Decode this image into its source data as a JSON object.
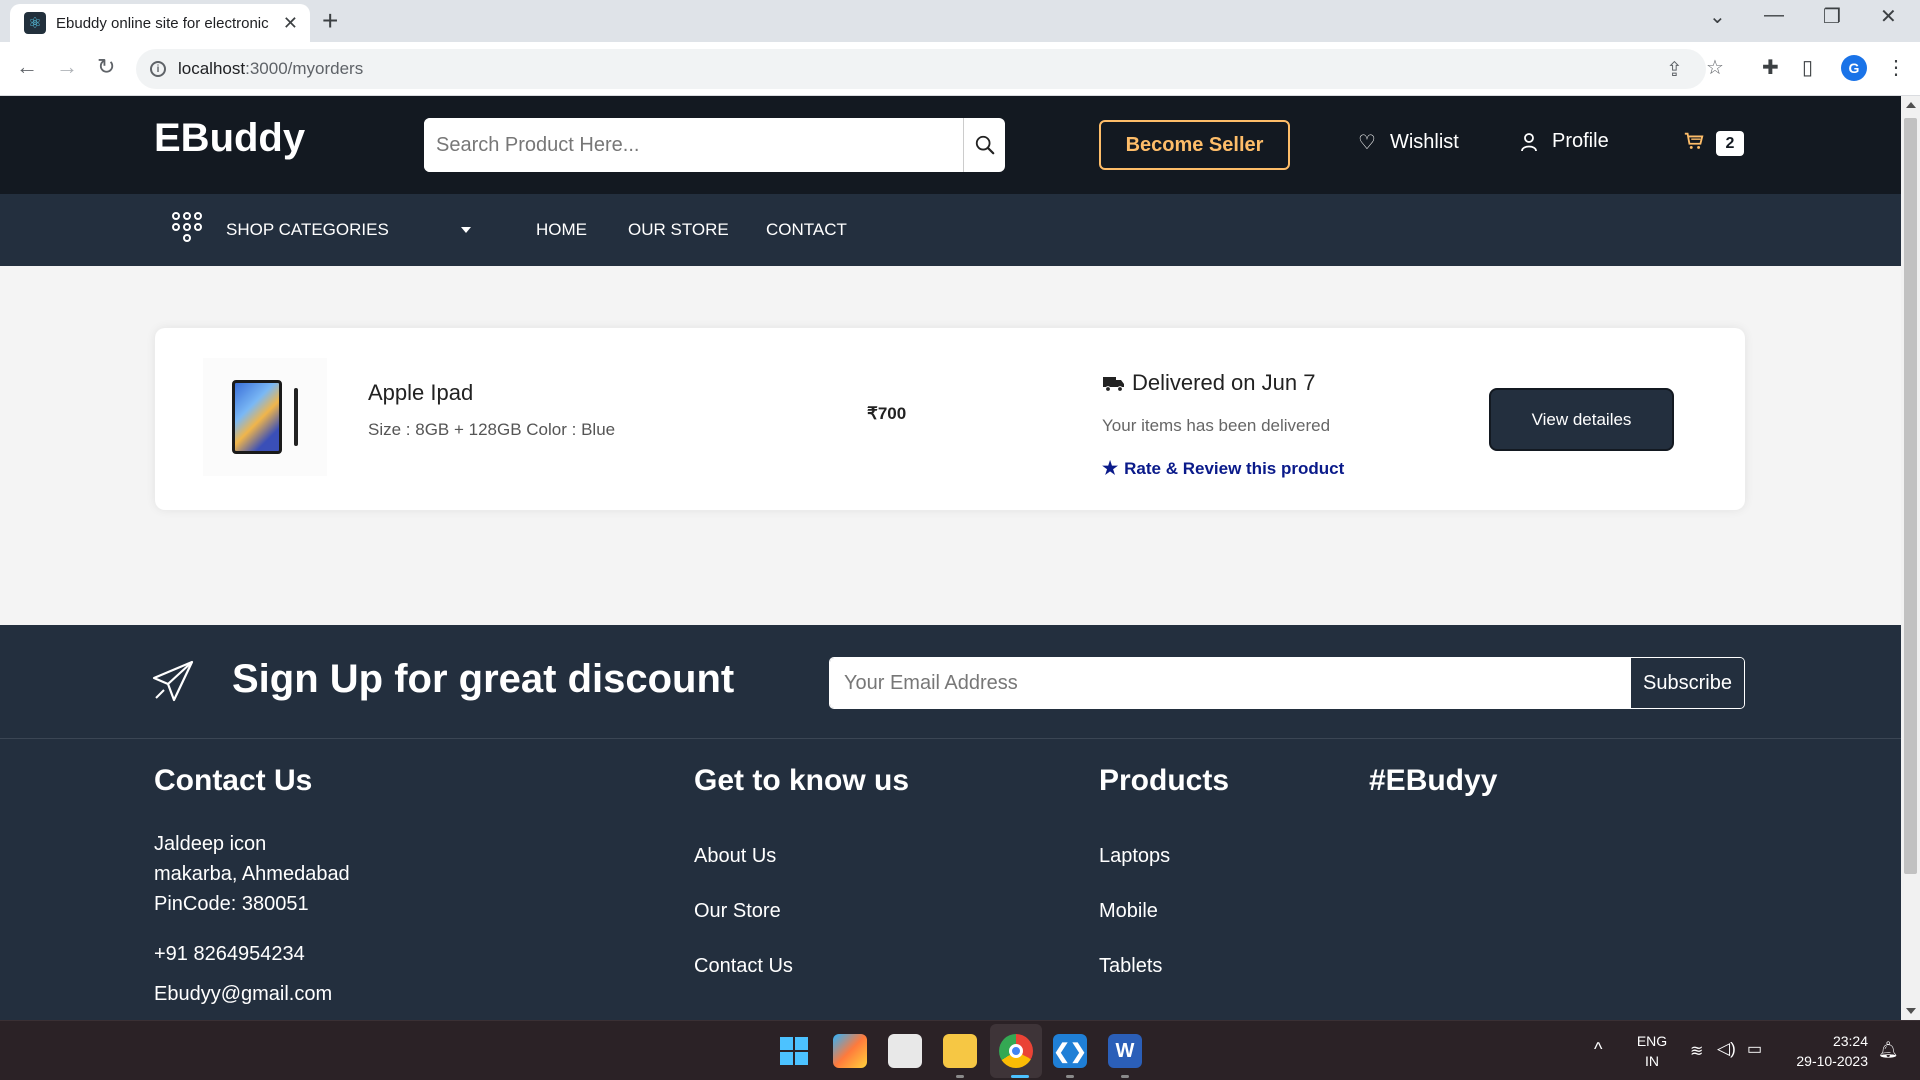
{
  "browser": {
    "tab_title": "Ebuddy online site for electronic",
    "url_host": "localhost",
    "url_path": ":3000/myorders"
  },
  "header": {
    "logo": "EBuddy",
    "search_placeholder": "Search Product Here...",
    "become_seller": "Become Seller",
    "wishlist": "Wishlist",
    "profile": "Profile",
    "cart_count": "2"
  },
  "nav": {
    "categories": "SHOP CATEGORIES",
    "links": [
      "HOME",
      "OUR STORE",
      "CONTACT"
    ]
  },
  "order": {
    "product_name": "Apple Ipad",
    "specs": "Size : 8GB + 128GB Color : Blue",
    "price": "₹700",
    "delivery_title": "Delivered on Jun 7",
    "delivery_sub": "Your items has been delivered",
    "rate_link": "Rate & Review this product",
    "view_button": "View detailes"
  },
  "newsletter": {
    "title": "Sign Up for great discount",
    "email_placeholder": "Your Email Address",
    "subscribe": "Subscribe"
  },
  "footer": {
    "contact": {
      "heading": "Contact Us",
      "address_line1": "Jaldeep icon",
      "address_line2": "makarba, Ahmedabad",
      "address_line3": "PinCode: 380051",
      "phone": "+91 8264954234",
      "email": "Ebudyy@gmail.com"
    },
    "know_us": {
      "heading": "Get to know us",
      "links": [
        "About Us",
        "Our Store",
        "Contact Us"
      ]
    },
    "products": {
      "heading": "Products",
      "links": [
        "Laptops",
        "Mobile",
        "Tablets"
      ]
    },
    "hashtag": {
      "heading": "#EBudyy"
    }
  },
  "taskbar": {
    "lang_line1": "ENG",
    "lang_line2": "IN",
    "time": "23:24",
    "date": "29-10-2023"
  }
}
